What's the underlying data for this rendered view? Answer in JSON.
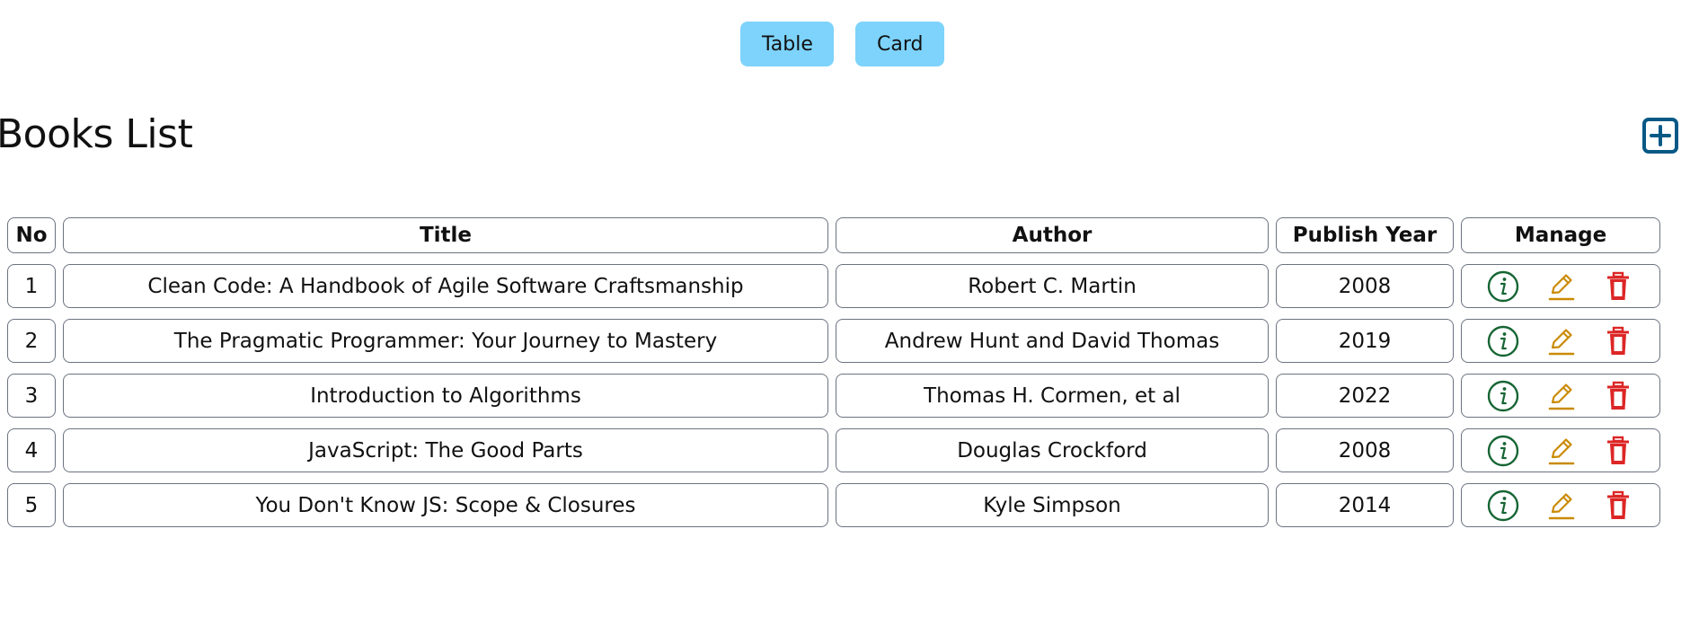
{
  "view_toggle": {
    "table_label": "Table",
    "card_label": "Card"
  },
  "page": {
    "title": "Books List",
    "add_icon": "plus-square-icon"
  },
  "table": {
    "headers": {
      "no": "No",
      "title": "Title",
      "author": "Author",
      "year": "Publish Year",
      "manage": "Manage"
    },
    "rows": [
      {
        "no": "1",
        "title": "Clean Code: A Handbook of Agile Software Craftsmanship",
        "author": "Robert C. Martin",
        "year": "2008"
      },
      {
        "no": "2",
        "title": "The Pragmatic Programmer: Your Journey to Mastery",
        "author": "Andrew Hunt and David Thomas",
        "year": "2019"
      },
      {
        "no": "3",
        "title": "Introduction to Algorithms",
        "author": "Thomas H. Cormen, et al",
        "year": "2022"
      },
      {
        "no": "4",
        "title": "JavaScript: The Good Parts",
        "author": "Douglas Crockford",
        "year": "2008"
      },
      {
        "no": "5",
        "title": "You Don't Know JS: Scope & Closures",
        "author": "Kyle Simpson",
        "year": "2014"
      }
    ],
    "manage_icons": [
      "info-circle-icon",
      "pencil-icon",
      "trash-icon"
    ]
  },
  "colors": {
    "toggle_bg": "#7dd3fc",
    "add_icon": "#075985",
    "info_icon": "#166534",
    "edit_icon": "#ca8a04",
    "delete_icon": "#dc2626",
    "cell_border": "#6b7280"
  }
}
